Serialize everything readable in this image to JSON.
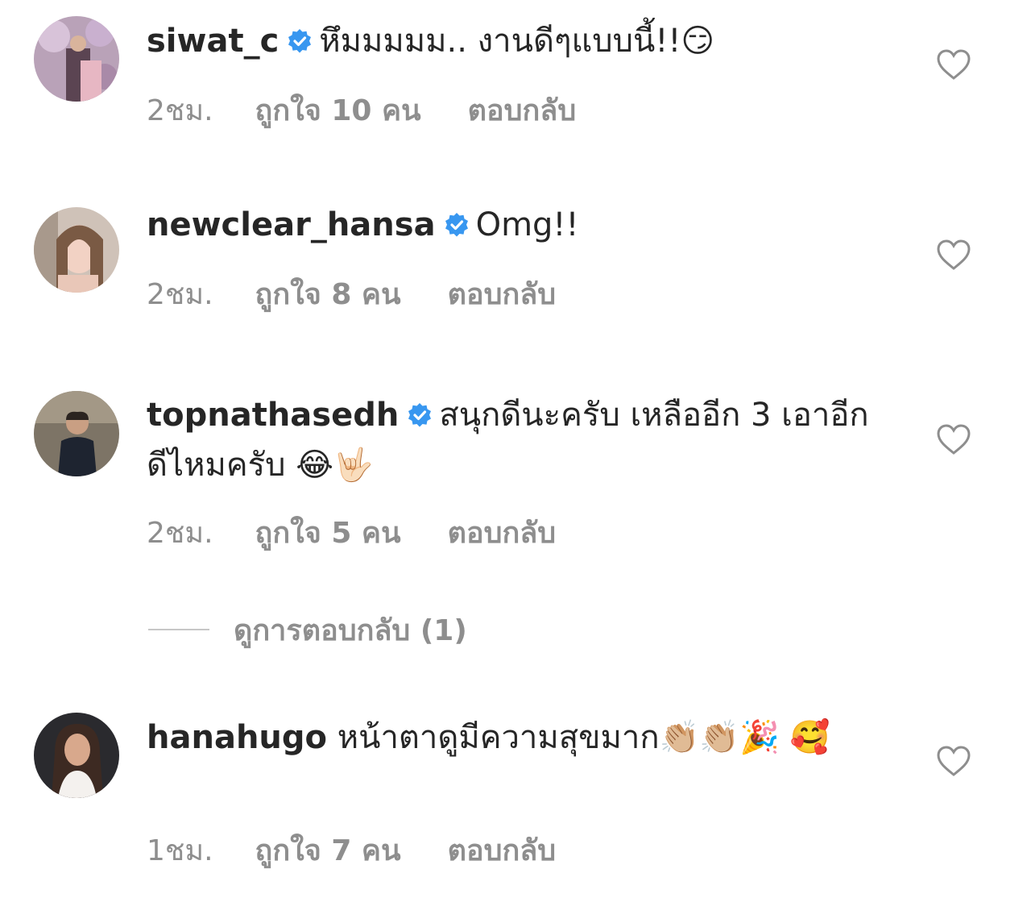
{
  "comments": [
    {
      "username": "siwat_c",
      "text": "หึมมมมม.. งานดีๆแบบนี้!!",
      "emoji": "😏",
      "time": "2ชม.",
      "likes": "ถูกใจ 10 คน",
      "reply": "ตอบกลับ",
      "verified": true
    },
    {
      "username": "newclear_hansa",
      "text": "Omg!!",
      "emoji": "",
      "time": "2ชม.",
      "likes": "ถูกใจ 8 คน",
      "reply": "ตอบกลับ",
      "verified": true
    },
    {
      "username": "topnathasedh",
      "text": "สนุกดีนะครับ เหลืออีก 3 เอาอีก ดีไหมครับ",
      "emoji": "😂🤟🏻",
      "time": "2ชม.",
      "likes": "ถูกใจ 5 คน",
      "reply": "ตอบกลับ",
      "verified": true
    },
    {
      "username": "hanahugo",
      "text": "หน้าตาดูมีความสุขมาก",
      "emoji": "👏🏼👏🏼🎉 🥰",
      "time": "1ชม.",
      "likes": "ถูกใจ 7 คน",
      "reply": "ตอบกลับ",
      "verified": false
    }
  ],
  "view_replies": "ดูการตอบกลับ (1)",
  "icons": {
    "verified": "verified-badge-icon",
    "like": "heart-outline-icon"
  },
  "colors": {
    "text": "#262626",
    "secondary": "#8e8e8e",
    "verified": "#3897f0",
    "divider": "#c7c7c7"
  }
}
